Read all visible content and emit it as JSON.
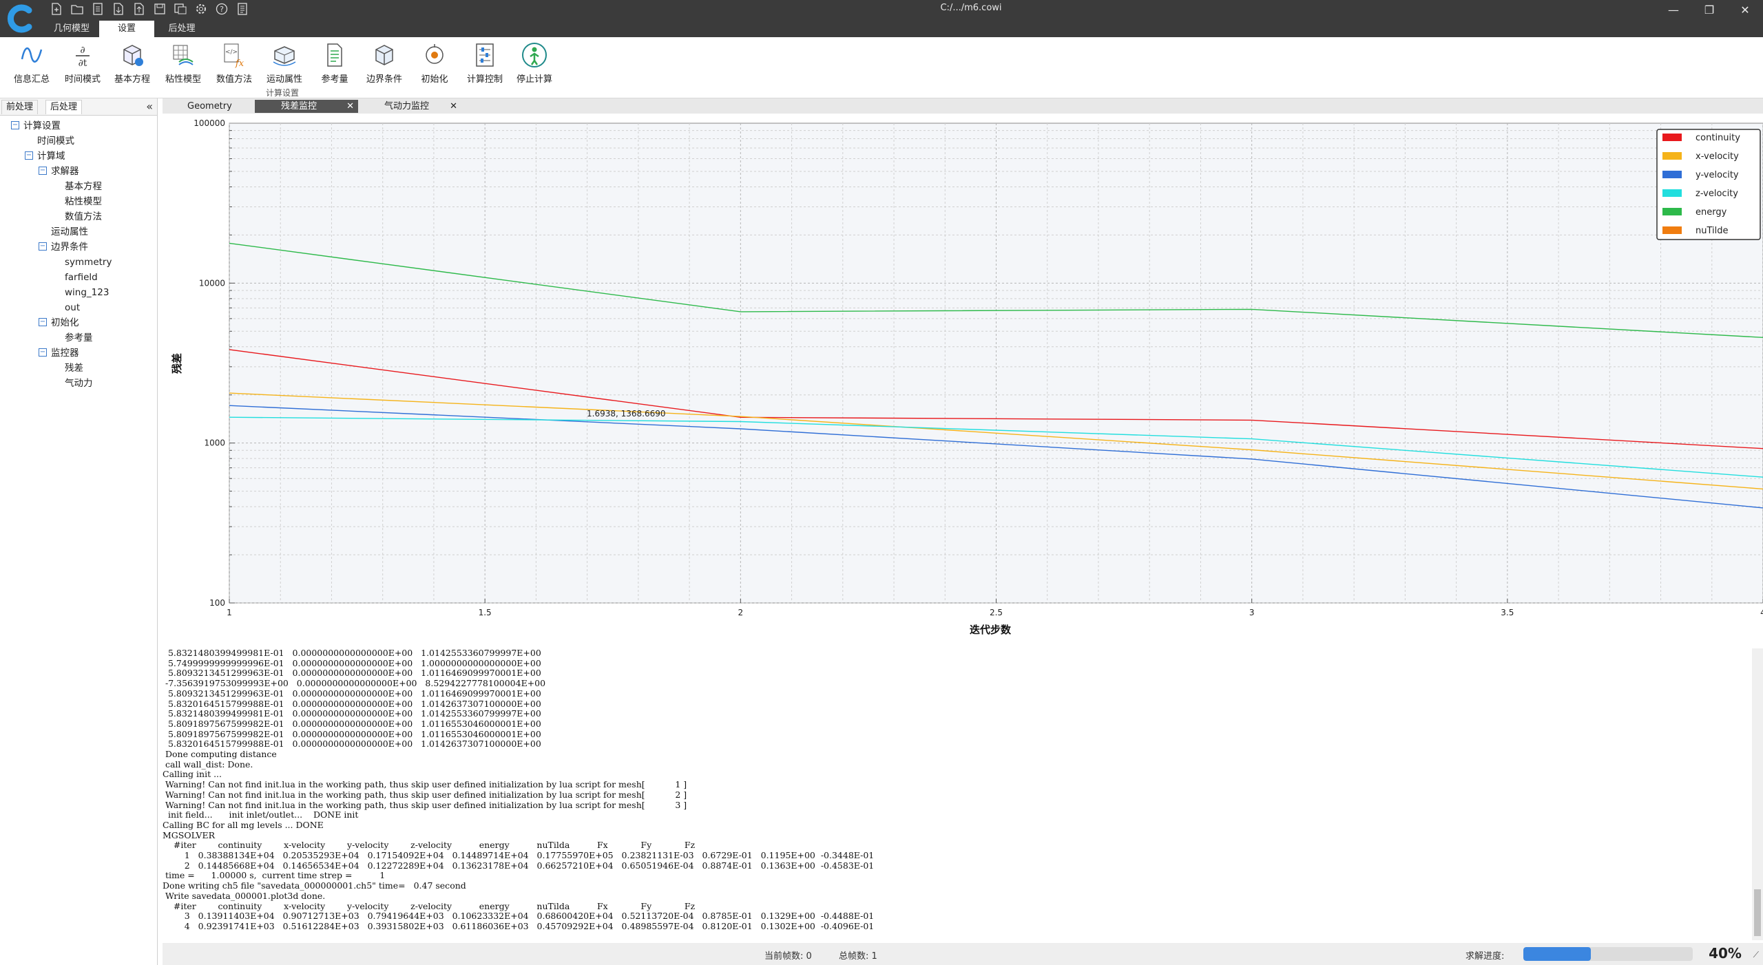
{
  "app": {
    "window_title": "C:/.../m6.cowi",
    "menu_tabs": [
      "几何模型",
      "设置",
      "后处理"
    ],
    "active_menu_tab": 1,
    "window_controls": [
      "—",
      "❐",
      "✕"
    ]
  },
  "ribbon": {
    "buttons": [
      {
        "label": "信息汇总",
        "icon": "info-summary-icon"
      },
      {
        "label": "时间模式",
        "icon": "time-mode-icon"
      },
      {
        "label": "基本方程",
        "icon": "basic-equation-icon"
      },
      {
        "label": "粘性模型",
        "icon": "viscous-model-icon"
      },
      {
        "label": "数值方法",
        "icon": "numerical-method-icon"
      },
      {
        "label": "运动属性",
        "icon": "motion-property-icon"
      },
      {
        "label": "参考量",
        "icon": "reference-quantity-icon"
      },
      {
        "label": "边界条件",
        "icon": "boundary-condition-icon"
      },
      {
        "label": "初始化",
        "icon": "initialize-icon"
      },
      {
        "label": "计算控制",
        "icon": "compute-control-icon"
      },
      {
        "label": "停止计算",
        "icon": "stop-compute-icon"
      }
    ],
    "group_label": "计算设置"
  },
  "left_panel": {
    "tabs": [
      "前处理",
      "后处理"
    ],
    "active_tab": 1,
    "collapse_icon": "«",
    "tree": [
      {
        "label": "计算设置",
        "level": 0,
        "toggle": "−"
      },
      {
        "label": "时间模式",
        "level": 1,
        "toggle": ""
      },
      {
        "label": "计算域",
        "level": 1,
        "toggle": "−"
      },
      {
        "label": "求解器",
        "level": 2,
        "toggle": "−"
      },
      {
        "label": "基本方程",
        "level": 3,
        "toggle": ""
      },
      {
        "label": "粘性模型",
        "level": 3,
        "toggle": ""
      },
      {
        "label": "数值方法",
        "level": 3,
        "toggle": ""
      },
      {
        "label": "运动属性",
        "level": 2,
        "toggle": ""
      },
      {
        "label": "边界条件",
        "level": 2,
        "toggle": "−"
      },
      {
        "label": "symmetry",
        "level": 3,
        "toggle": ""
      },
      {
        "label": "farfield",
        "level": 3,
        "toggle": ""
      },
      {
        "label": "wing_123",
        "level": 3,
        "toggle": ""
      },
      {
        "label": "out",
        "level": 3,
        "toggle": ""
      },
      {
        "label": "初始化",
        "level": 2,
        "toggle": "−"
      },
      {
        "label": "参考量",
        "level": 3,
        "toggle": ""
      },
      {
        "label": "监控器",
        "level": 2,
        "toggle": "−"
      },
      {
        "label": "残差",
        "level": 3,
        "toggle": ""
      },
      {
        "label": "气动力",
        "level": 3,
        "toggle": ""
      }
    ]
  },
  "doc_tabs": [
    {
      "label": "Geometry",
      "close": ""
    },
    {
      "label": "残差监控",
      "close": "✕"
    },
    {
      "label": "气动力监控",
      "close": "✕"
    }
  ],
  "active_doc_tab": 1,
  "chart_data": {
    "type": "line",
    "xlabel": "迭代步数",
    "ylabel": "残差",
    "x": [
      1,
      2,
      3,
      4
    ],
    "xlim": [
      1,
      4
    ],
    "ylim": [
      100,
      100000
    ],
    "yscale": "log",
    "x_ticks": [
      "1",
      "1.5",
      "2",
      "2.5",
      "3",
      "3.5",
      "4"
    ],
    "y_ticks": [
      "100",
      "1000",
      "10000",
      "100000"
    ],
    "grid": true,
    "legend_position": "top-right",
    "annotation": "1.6938, 1368.6690",
    "series": [
      {
        "name": "continuity",
        "color": "#e8191d",
        "values": [
          3838.8,
          1448.6,
          1391.1,
          923.9
        ]
      },
      {
        "name": "x-velocity",
        "color": "#f5b319",
        "values": [
          2053.5,
          1465.7,
          907.1,
          516.1
        ]
      },
      {
        "name": "y-velocity",
        "color": "#2f6ed6",
        "values": [
          1715.4,
          1227.2,
          794.2,
          393.2
        ]
      },
      {
        "name": "z-velocity",
        "color": "#22dede",
        "values": [
          1449.0,
          1362.3,
          1062.3,
          611.9
        ]
      },
      {
        "name": "energy",
        "color": "#2db94a",
        "values": [
          17756,
          6626,
          6860,
          4571
        ]
      },
      {
        "name": "nuTilde",
        "color": "#f07d10",
        "values": [
          0.0002382,
          6.51e-05,
          5.21e-05,
          4.9e-05
        ]
      }
    ]
  },
  "console": {
    "lines": [
      "  5.8321480399499981E-01   0.0000000000000000E+00   1.0142553360799997E+00",
      "  5.7499999999999996E-01   0.0000000000000000E+00   1.0000000000000000E+00",
      "  5.8093213451299963E-01   0.0000000000000000E+00   1.0116469099970001E+00",
      " -7.3563919753099993E+00   0.0000000000000000E+00   8.5294227778100004E+00",
      "  5.8093213451299963E-01   0.0000000000000000E+00   1.0116469099970001E+00",
      "  5.8320164515799988E-01   0.0000000000000000E+00   1.0142637307100000E+00",
      "  5.8321480399499981E-01   0.0000000000000000E+00   1.0142553360799997E+00",
      "  5.8091897567599982E-01   0.0000000000000000E+00   1.0116553046000001E+00",
      "  5.8091897567599982E-01   0.0000000000000000E+00   1.0116553046000001E+00",
      "  5.8320164515799988E-01   0.0000000000000000E+00   1.0142637307100000E+00",
      " Done computing distance",
      " call wall_dist: Done.",
      "Calling init ...",
      " Warning! Can not find init.lua in the working path, thus skip user defined initialization by lua script for mesh[           1 ]",
      " Warning! Can not find init.lua in the working path, thus skip user defined initialization by lua script for mesh[           2 ]",
      " Warning! Can not find init.lua in the working path, thus skip user defined initialization by lua script for mesh[           3 ]",
      "  init field...      init inlet/outlet...    DONE init",
      "Calling BC for all mg levels ... DONE",
      "MGSOLVER",
      "    #iter        continuity        x-velocity        y-velocity        z-velocity          energy          nuTilda          Fx            Fy            Fz",
      "        1   0.38388134E+04   0.20535293E+04   0.17154092E+04   0.14489714E+04   0.17755970E+05   0.23821131E-03   0.6729E-01   0.1195E+00  -0.3448E-01",
      "        2   0.14485668E+04   0.14656534E+04   0.12272289E+04   0.13623178E+04   0.66257210E+04   0.65051946E-04   0.8874E-01   0.1363E+00  -0.4583E-01",
      " time =      1.00000 s,  current time strep =          1",
      "Done writing ch5 file \"savedata_000000001.ch5\" time=   0.47 second",
      " Write savedata_000001.plot3d done.",
      "    #iter        continuity        x-velocity        y-velocity        z-velocity          energy          nuTilda          Fx            Fy            Fz",
      "        3   0.13911403E+04   0.90712713E+03   0.79419644E+03   0.10623332E+04   0.68600420E+04   0.52113720E-04   0.8785E-01   0.1329E+00  -0.4488E-01",
      "        4   0.92391741E+03   0.51612284E+03   0.39315802E+03   0.61186036E+03   0.45709292E+04   0.48985597E-04   0.8120E-01   0.1302E+00  -0.4096E-01"
    ]
  },
  "status": {
    "current_frames_label": "当前帧数: 0",
    "total_frames_label": "总帧数: 1",
    "progress_label": "求解进度:",
    "progress_value": 0.4,
    "progress_text": "40%",
    "resize_icon": "⟋"
  }
}
